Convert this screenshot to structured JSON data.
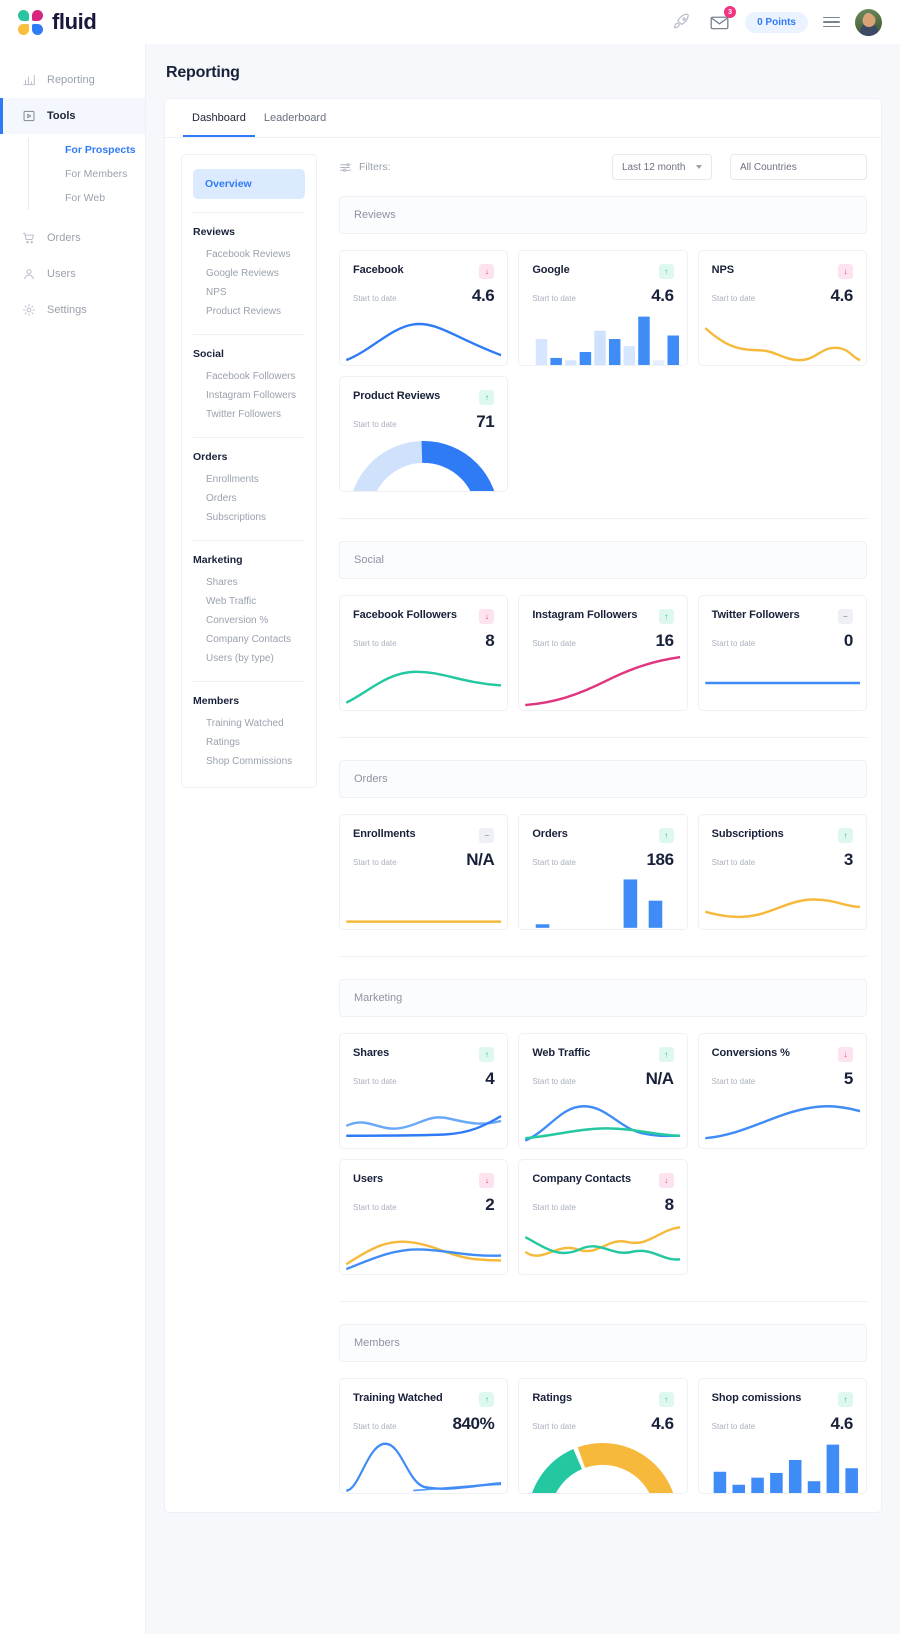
{
  "brand": {
    "name": "fluid"
  },
  "topbar": {
    "rocket_icon": "rocket-icon",
    "mail_icon": "envelope-icon",
    "mail_badge": "3",
    "points_label": "0 Points",
    "menu_icon": "hamburger-icon",
    "avatar": "user-avatar"
  },
  "sidebar": {
    "items": [
      {
        "label": "Reporting",
        "icon": "chart-icon",
        "active": false
      },
      {
        "label": "Tools",
        "icon": "tools-icon",
        "active": true
      },
      {
        "label": "Orders",
        "icon": "cart-icon",
        "active": false
      },
      {
        "label": "Users",
        "icon": "user-icon",
        "active": false
      },
      {
        "label": "Settings",
        "icon": "gear-icon",
        "active": false
      }
    ],
    "sub_items": [
      {
        "label": "For Prospects",
        "active": true
      },
      {
        "label": "For Members",
        "active": false
      },
      {
        "label": "For Web",
        "active": false
      }
    ]
  },
  "page": {
    "title": "Reporting"
  },
  "tabs": [
    {
      "label": "Dashboard",
      "active": true
    },
    {
      "label": "Leaderboard",
      "active": false
    }
  ],
  "filters": {
    "label": "Filters:",
    "filter_icon": "sliders-icon",
    "period": "Last 12 month",
    "country": "All Countries"
  },
  "report_menu": {
    "overview": "Overview",
    "groups": [
      {
        "title": "Reviews",
        "links": [
          "Facebook Reviews",
          "Google Reviews",
          "NPS",
          "Product Reviews"
        ]
      },
      {
        "title": "Social",
        "links": [
          "Facebook Followers",
          "Instagram Followers",
          "Twitter Followers"
        ]
      },
      {
        "title": "Orders",
        "links": [
          "Enrollments",
          "Orders",
          "Subscriptions"
        ]
      },
      {
        "title": "Marketing",
        "links": [
          "Shares",
          "Web Traffic",
          "Conversion %",
          "Company Contacts",
          "Users (by type)"
        ]
      },
      {
        "title": "Members",
        "links": [
          "Training Watched",
          "Ratings",
          "Shop Commissions"
        ]
      }
    ]
  },
  "sub_label": "Start to date",
  "sections": [
    {
      "title": "Reviews",
      "cards": [
        {
          "title": "Facebook",
          "value": "4.6",
          "trend": "down",
          "trend_glyph": "↓",
          "viz": "line-blue"
        },
        {
          "title": "Google",
          "value": "4.6",
          "trend": "up",
          "trend_glyph": "↑",
          "viz": "bars-blue"
        },
        {
          "title": "NPS",
          "value": "4.6",
          "trend": "down",
          "trend_glyph": "↓",
          "viz": "line-orange"
        },
        {
          "title": "Product Reviews",
          "value": "71",
          "trend": "up",
          "trend_glyph": "↑",
          "viz": "donut-blue"
        }
      ]
    },
    {
      "title": "Social",
      "cards": [
        {
          "title": "Facebook Followers",
          "value": "8",
          "trend": "down",
          "trend_glyph": "↓",
          "viz": "line-green"
        },
        {
          "title": "Instagram Followers",
          "value": "16",
          "trend": "up",
          "trend_glyph": "↑",
          "viz": "line-pink"
        },
        {
          "title": "Twitter Followers",
          "value": "0",
          "trend": "flat",
          "trend_glyph": "–",
          "viz": "line-flat-blue"
        }
      ]
    },
    {
      "title": "Orders",
      "cards": [
        {
          "title": "Enrollments",
          "value": "N/A",
          "trend": "flat",
          "trend_glyph": "–",
          "viz": "line-flat-orange"
        },
        {
          "title": "Orders",
          "value": "186",
          "trend": "up",
          "trend_glyph": "↑",
          "viz": "bars-orders"
        },
        {
          "title": "Subscriptions",
          "value": "3",
          "trend": "up",
          "trend_glyph": "↑",
          "viz": "line-orange-wave"
        }
      ]
    },
    {
      "title": "Marketing",
      "cards": [
        {
          "title": "Shares",
          "value": "4",
          "trend": "up",
          "trend_glyph": "↑",
          "viz": "line-duo-blue"
        },
        {
          "title": "Web Traffic",
          "value": "N/A",
          "trend": "up",
          "trend_glyph": "↑",
          "viz": "line-duo-green"
        },
        {
          "title": "Conversions %",
          "value": "5",
          "trend": "down",
          "trend_glyph": "↓",
          "viz": "line-blue-hump"
        },
        {
          "title": "Users",
          "value": "2",
          "trend": "down",
          "trend_glyph": "↓",
          "viz": "line-duo-orange"
        },
        {
          "title": "Company Contacts",
          "value": "8",
          "trend": "down",
          "trend_glyph": "↓",
          "viz": "line-duo-teal"
        }
      ]
    },
    {
      "title": "Members",
      "cards": [
        {
          "title": "Training Watched",
          "value": "840%",
          "trend": "up",
          "trend_glyph": "↑",
          "viz": "line-peak-blue"
        },
        {
          "title": "Ratings",
          "value": "4.6",
          "trend": "up",
          "trend_glyph": "↑",
          "viz": "donut-multi"
        },
        {
          "title": "Shop comissions",
          "value": "4.6",
          "trend": "up",
          "trend_glyph": "↑",
          "viz": "bars-shop"
        }
      ]
    }
  ],
  "chart_data": [
    {
      "type": "line",
      "title": "Facebook",
      "y": [
        10,
        28,
        44,
        52,
        50,
        40,
        30,
        22
      ],
      "color": "#2f7bf6"
    },
    {
      "type": "bar",
      "title": "Google",
      "values": [
        28,
        8,
        5,
        14,
        38,
        30,
        18,
        62,
        4,
        34
      ],
      "colors": [
        "#d6e6ff",
        "#3f8cf7",
        "#d6e6ff",
        "#3f8cf7",
        "#cfe2fd",
        "#3f8cf7",
        "#d6e6ff",
        "#3f8cf7",
        "#e4eefe",
        "#3f8cf7"
      ]
    },
    {
      "type": "line",
      "title": "NPS",
      "y": [
        55,
        38,
        28,
        26,
        30,
        22,
        26,
        24
      ],
      "color": "#f6b93b"
    },
    {
      "type": "pie",
      "title": "Product Reviews",
      "values": [
        71,
        29
      ],
      "colors": [
        "#2f7bf6",
        "#cfe1fb"
      ]
    },
    {
      "type": "line",
      "title": "Facebook Followers",
      "y": [
        8,
        26,
        40,
        44,
        40,
        32,
        30,
        30
      ],
      "color": "#23c8a0"
    },
    {
      "type": "line",
      "title": "Instagram Followers",
      "y": [
        6,
        10,
        16,
        26,
        42,
        58,
        68,
        74
      ],
      "color": "#e0357f"
    },
    {
      "type": "line",
      "title": "Twitter Followers",
      "y": [
        0,
        0,
        0,
        0,
        0,
        0
      ],
      "color": "#3f8cf7"
    },
    {
      "type": "line",
      "title": "Enrollments",
      "y": [
        0,
        0,
        0,
        0,
        0,
        0
      ],
      "color": "#f6b93b"
    },
    {
      "type": "bar",
      "title": "Orders",
      "values": [
        2,
        0,
        0,
        0,
        58,
        0,
        30
      ],
      "colors": [
        "#3f8cf7",
        "#3f8cf7",
        "#3f8cf7",
        "#3f8cf7",
        "#3f8cf7",
        "#3f8cf7",
        "#3f8cf7"
      ]
    },
    {
      "type": "line",
      "title": "Subscriptions",
      "y": [
        20,
        18,
        14,
        18,
        28,
        30,
        24,
        26
      ],
      "color": "#f6b93b"
    },
    {
      "type": "line",
      "title": "Shares",
      "series": [
        {
          "name": "a",
          "values": [
            16,
            14,
            20,
            12,
            18,
            14,
            16
          ],
          "color": "#3f8cf7"
        },
        {
          "name": "b",
          "values": [
            10,
            10,
            10,
            10,
            10,
            12,
            24
          ],
          "color": "#2f7bf6"
        }
      ]
    },
    {
      "type": "line",
      "title": "Web Traffic",
      "series": [
        {
          "name": "a",
          "values": [
            8,
            22,
            34,
            30,
            18,
            12,
            10
          ],
          "color": "#3f8cf7"
        },
        {
          "name": "b",
          "values": [
            8,
            10,
            14,
            16,
            14,
            12,
            10
          ],
          "color": "#23c8a0"
        }
      ]
    },
    {
      "type": "line",
      "title": "Conversions %",
      "y": [
        4,
        8,
        14,
        24,
        32,
        34,
        30,
        22
      ],
      "color": "#3f8cf7"
    },
    {
      "type": "line",
      "title": "Users",
      "series": [
        {
          "name": "a",
          "values": [
            6,
            22,
            30,
            28,
            18,
            14,
            14
          ],
          "color": "#f6b93b"
        },
        {
          "name": "b",
          "values": [
            4,
            10,
            20,
            24,
            20,
            16,
            16
          ],
          "color": "#3f8cf7"
        }
      ]
    },
    {
      "type": "line",
      "title": "Company Contacts",
      "series": [
        {
          "name": "a",
          "values": [
            18,
            10,
            22,
            14,
            26,
            18,
            30
          ],
          "color": "#f6b93b"
        },
        {
          "name": "b",
          "values": [
            26,
            20,
            12,
            22,
            14,
            22,
            12
          ],
          "color": "#23c8a0"
        }
      ]
    },
    {
      "type": "line",
      "title": "Training Watched",
      "y": [
        2,
        10,
        42,
        60,
        30,
        10,
        6,
        6
      ],
      "color": "#3f8cf7"
    },
    {
      "type": "pie",
      "title": "Ratings",
      "values": [
        55,
        22,
        23
      ],
      "colors": [
        "#f6b93b",
        "#e0357f",
        "#23c8a0"
      ]
    },
    {
      "type": "bar",
      "title": "Shop comissions",
      "values": [
        26,
        10,
        18,
        24,
        40,
        14,
        58,
        30
      ],
      "colors": [
        "#3f8cf7",
        "#3f8cf7",
        "#3f8cf7",
        "#3f8cf7",
        "#3f8cf7",
        "#3f8cf7",
        "#3f8cf7",
        "#3f8cf7"
      ]
    }
  ]
}
